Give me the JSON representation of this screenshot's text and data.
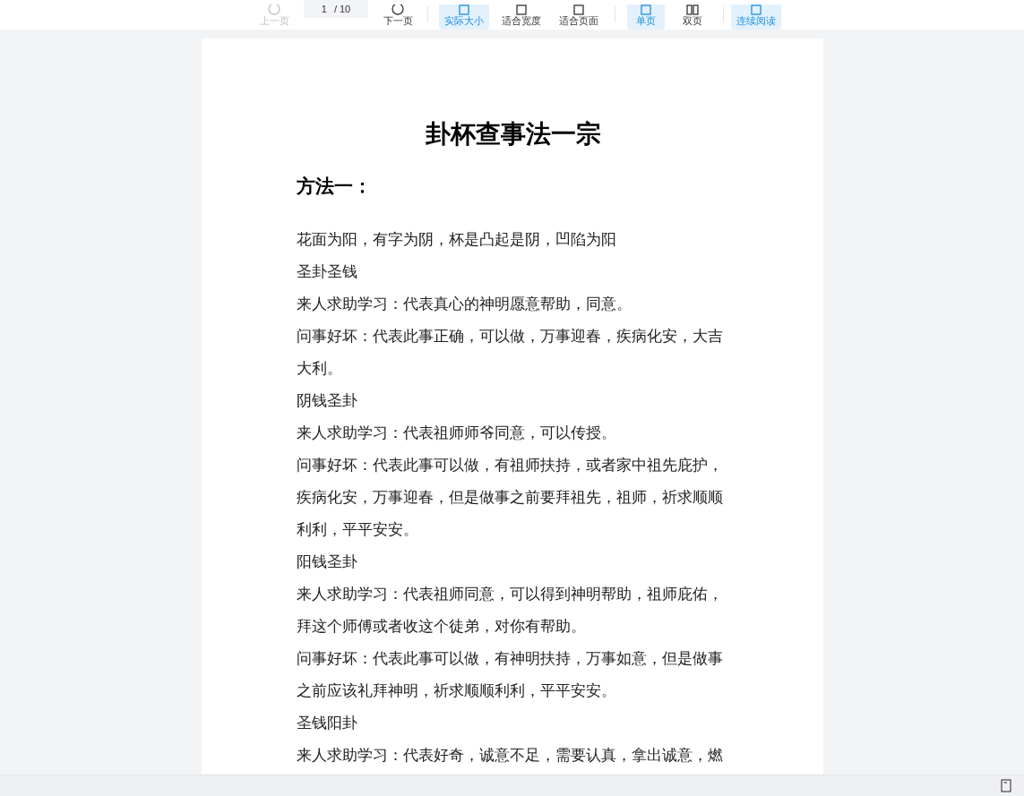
{
  "toolbar": {
    "prev": {
      "label": "上一页",
      "disabled": true
    },
    "page_input": {
      "value": "1",
      "total": "/ 10"
    },
    "next": {
      "label": "下一页",
      "disabled": false
    },
    "zoom_modes": [
      {
        "label": "实际大小",
        "selected": true
      },
      {
        "label": "适合宽度",
        "selected": false
      },
      {
        "label": "适合页面",
        "selected": false
      }
    ],
    "page_modes": [
      {
        "label": "单页",
        "selected": true
      },
      {
        "label": "双页",
        "selected": false
      }
    ],
    "continuous": {
      "label": "连续阅读",
      "selected": true
    }
  },
  "document": {
    "title": "卦杯查事法一宗",
    "heading": "方法一：",
    "paragraphs": [
      "花面为阳，有字为阴，杯是凸起是阴，凹陷为阳",
      "圣卦圣钱",
      "来人求助学习：代表真心的神明愿意帮助，同意。",
      "问事好坏：代表此事正确，可以做，万事迎春，疾病化安，大吉大利。",
      "阴钱圣卦",
      "来人求助学习：代表祖师师爷同意，可以传授。",
      "问事好坏：代表此事可以做，有祖师扶持，或者家中祖先庇护，疾病化安，万事迎春，但是做事之前要拜祖先，祖师，祈求顺顺利利，平平安安。",
      "阳钱圣卦",
      "来人求助学习：代表祖师同意，可以得到神明帮助，祖师庇佑，拜这个师傅或者收这个徒弟，对你有帮助。",
      "问事好坏：代表此事可以做，有神明扶持，万事如意，但是做事之前应该礼拜神明，祈求顺顺利利，平平安安。",
      "圣钱阳卦",
      "来人求助学习：代表好奇，诚意不足，需要认真，拿出诚意，燃"
    ]
  }
}
